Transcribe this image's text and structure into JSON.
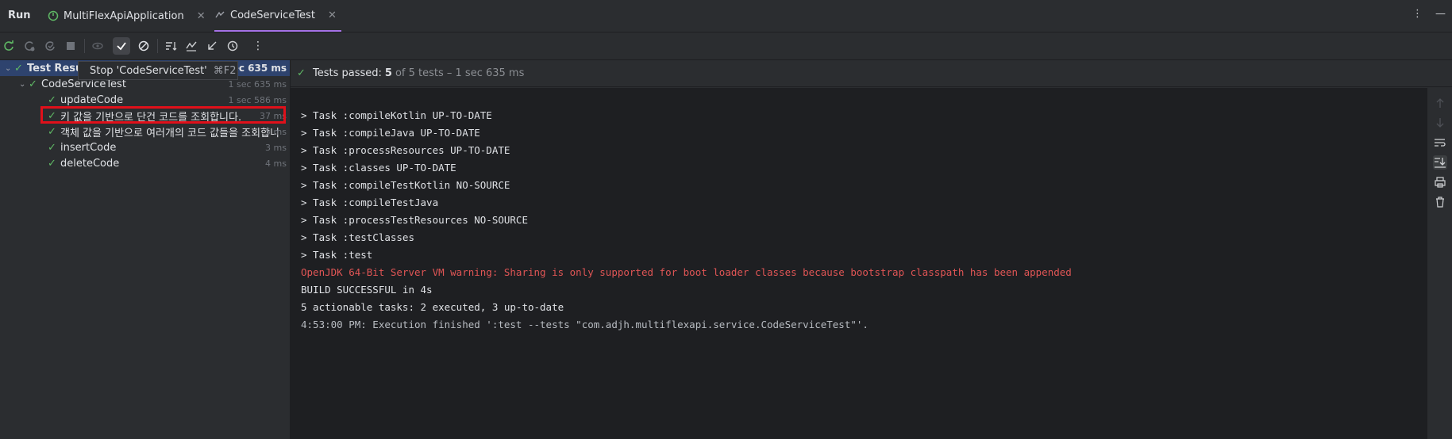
{
  "header": {
    "run_label": "Run",
    "tabs": [
      {
        "label": "MultiFlexApiApplication",
        "active": false
      },
      {
        "label": "CodeServiceTest",
        "active": true
      }
    ]
  },
  "tooltip": {
    "text": "Stop 'CodeServiceTest'",
    "shortcut": "⌘F2"
  },
  "tree": {
    "root": {
      "label": "Test Resu",
      "time": "ec 635 ms"
    },
    "class": {
      "label": "CodeServiceTest",
      "time": "1 sec 635 ms"
    },
    "tests": [
      {
        "label": "updateCode",
        "time": "1 sec 586 ms"
      },
      {
        "label": "키 값을 기반으로 단건 코드를 조회합니다.",
        "time": "37 ms"
      },
      {
        "label": "객체 값을 기반으로 여러개의 코드 값들을 조회합니",
        "time": "5 ms"
      },
      {
        "label": "insertCode",
        "time": "3 ms"
      },
      {
        "label": "deleteCode",
        "time": "4 ms"
      }
    ]
  },
  "status": {
    "prefix": "Tests passed:",
    "count": "5",
    "rest": "of 5 tests – 1 sec 635 ms"
  },
  "console": {
    "lines": [
      "> Task :compileKotlin UP-TO-DATE",
      "> Task :compileJava UP-TO-DATE",
      "> Task :processResources UP-TO-DATE",
      "> Task :classes UP-TO-DATE",
      "> Task :compileTestKotlin NO-SOURCE",
      "> Task :compileTestJava",
      "> Task :processTestResources NO-SOURCE",
      "> Task :testClasses",
      "> Task :test",
      "OpenJDK 64-Bit Server VM warning: Sharing is only supported for boot loader classes because bootstrap classpath has been appended",
      "BUILD SUCCESSFUL in 4s",
      "5 actionable tasks: 2 executed, 3 up-to-date",
      "4:53:00 PM: Execution finished ':test --tests \"com.adjh.multiflexapi.service.CodeServiceTest\"'."
    ]
  },
  "colors": {
    "accent": "#a571e6",
    "pass": "#5fb865",
    "warning": "#e05555",
    "highlight": "#e0101a"
  }
}
